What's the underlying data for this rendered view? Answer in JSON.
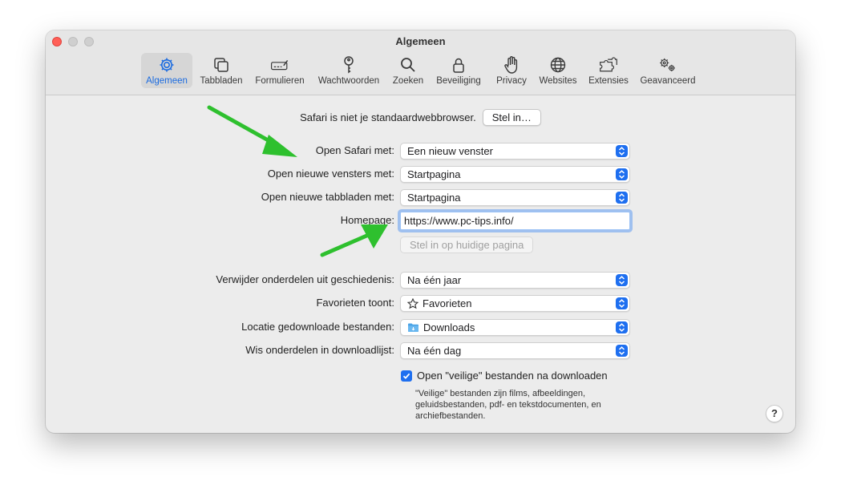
{
  "window": {
    "title": "Algemeen"
  },
  "toolbar": {
    "items": [
      {
        "label": "Algemeen",
        "icon": "gear-icon",
        "active": true
      },
      {
        "label": "Tabbladen",
        "icon": "tabs-icon"
      },
      {
        "label": "Formulieren",
        "icon": "form-pencil-icon"
      },
      {
        "label": "Wachtwoorden",
        "icon": "key-icon"
      },
      {
        "label": "Zoeken",
        "icon": "magnifier-icon"
      },
      {
        "label": "Beveiliging",
        "icon": "lock-icon"
      },
      {
        "label": "Privacy",
        "icon": "hand-icon"
      },
      {
        "label": "Websites",
        "icon": "globe-icon"
      },
      {
        "label": "Extensies",
        "icon": "puzzle-icon"
      },
      {
        "label": "Geavanceerd",
        "icon": "gears-icon"
      }
    ]
  },
  "default_browser": {
    "text": "Safari is niet je standaardwebbrowser.",
    "button": "Stel in…"
  },
  "settings": {
    "open_safari": {
      "label": "Open Safari met:",
      "value": "Een nieuw venster"
    },
    "new_windows": {
      "label": "Open nieuwe vensters met:",
      "value": "Startpagina"
    },
    "new_tabs": {
      "label": "Open nieuwe tabbladen met:",
      "value": "Startpagina"
    },
    "homepage": {
      "label": "Homepage:",
      "value": "https://www.pc-tips.info/",
      "button": "Stel in op huidige pagina"
    },
    "history": {
      "label": "Verwijder onderdelen uit geschiedenis:",
      "value": "Na één jaar"
    },
    "favorites": {
      "label": "Favorieten toont:",
      "value": "Favorieten"
    },
    "download_location": {
      "label": "Locatie gedownloade bestanden:",
      "value": "Downloads"
    },
    "download_list": {
      "label": "Wis onderdelen in downloadlijst:",
      "value": "Na één dag"
    }
  },
  "safe_files": {
    "label": "Open \"veilige\" bestanden na downloaden",
    "checked": true,
    "help": "\"Veilige\" bestanden zijn films, afbeeldingen, geluidsbestanden, pdf- en tekstdocumenten, en archiefbestanden."
  },
  "help_button": "?",
  "colors": {
    "accent": "#1e6ff0",
    "arrow": "#2ec02e",
    "close": "#ff5f57"
  }
}
